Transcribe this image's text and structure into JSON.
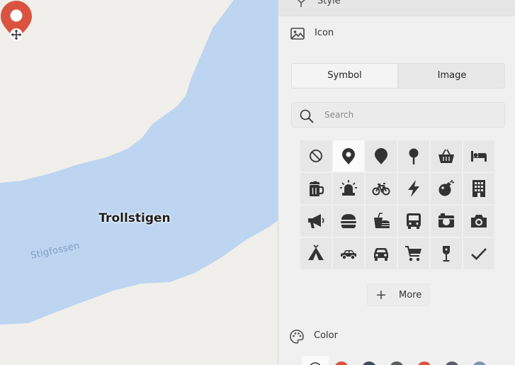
{
  "map": {
    "place_label": "Trollstigen",
    "water_label": "Stigfossen",
    "colors": {
      "land": "#f1efeb",
      "water": "#bdd5f1",
      "pin": "#d9533f"
    }
  },
  "panel": {
    "style_section": {
      "label": "Style",
      "icon": "paint-bucket-icon"
    },
    "icon_section": {
      "label": "Icon",
      "icon": "image-icon"
    },
    "tabs": [
      {
        "label": "Symbol",
        "active": true
      },
      {
        "label": "Image",
        "active": false
      }
    ],
    "search": {
      "placeholder": "Search",
      "value": "",
      "icon": "search-icon"
    },
    "icons": [
      [
        "no-symbol-icon",
        "map-pin-icon",
        "drop-pin-icon",
        "round-pin-icon",
        "shopping-basket-icon",
        "bed-icon"
      ],
      [
        "beer-mug-icon",
        "alarm-bell-icon",
        "bicycle-icon",
        "lightning-icon",
        "bomb-icon",
        "building-icon"
      ],
      [
        "megaphone-icon",
        "burger-icon",
        "fast-food-icon",
        "bus-icon",
        "camera-box-icon",
        "camera-icon"
      ],
      [
        "tent-icon",
        "car-side-icon",
        "car-front-icon",
        "shopping-cart-icon",
        "wine-glass-icon",
        "checkmark-icon"
      ]
    ],
    "selected_icon": "map-pin-icon",
    "more_button": {
      "label": "More"
    },
    "color_section": {
      "label": "Color",
      "icon": "palette-icon"
    },
    "swatch_colors": [
      "#d9533f",
      "#3b4a5e",
      "#55615c",
      "#d9533f",
      "#58606b",
      "#7d96b5"
    ]
  }
}
